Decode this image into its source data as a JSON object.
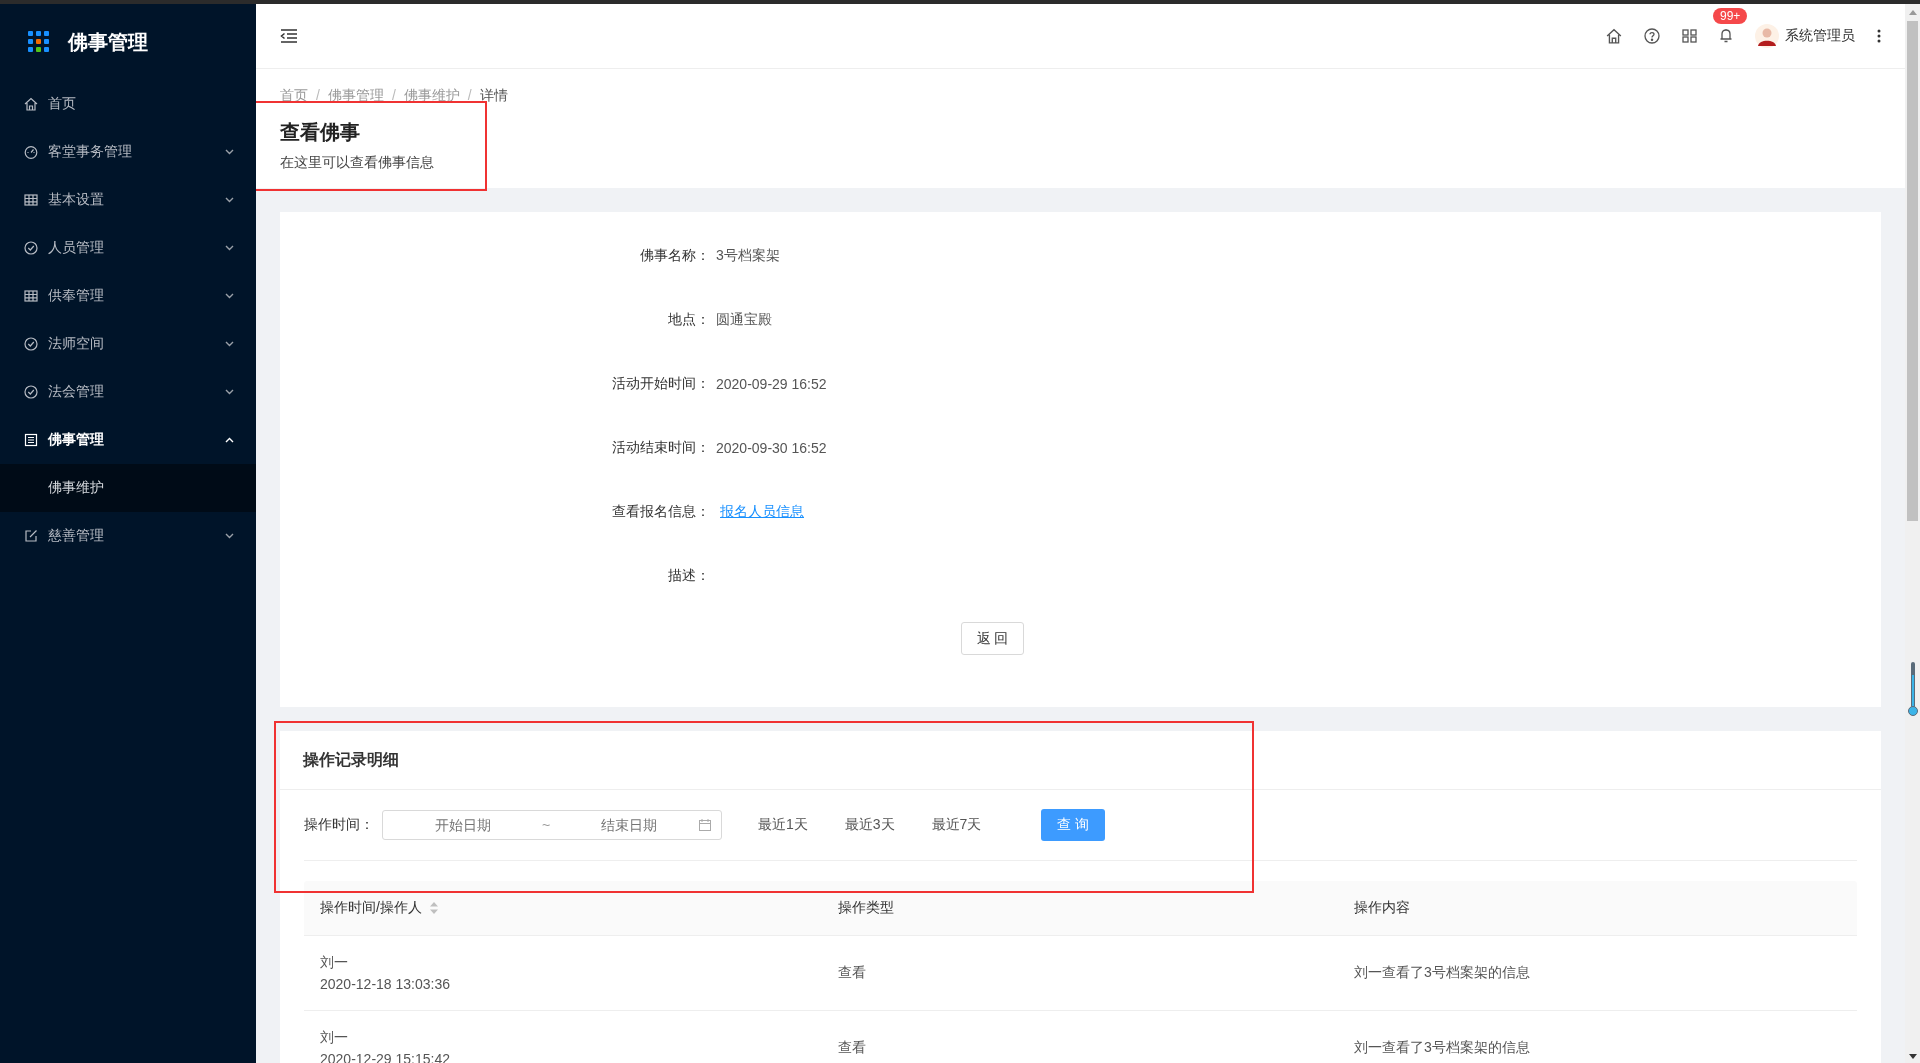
{
  "app": {
    "title": "佛事管理"
  },
  "sidebar": {
    "items": [
      {
        "label": "首页",
        "kind": "link",
        "selected": false
      },
      {
        "label": "客堂事务管理",
        "kind": "group",
        "expanded": false,
        "selected": false
      },
      {
        "label": "基本设置",
        "kind": "group",
        "expanded": false,
        "selected": false
      },
      {
        "label": "人员管理",
        "kind": "group",
        "expanded": false,
        "selected": false
      },
      {
        "label": "供奉管理",
        "kind": "group",
        "expanded": false,
        "selected": false
      },
      {
        "label": "法师空间",
        "kind": "group",
        "expanded": false,
        "selected": false
      },
      {
        "label": "法会管理",
        "kind": "group",
        "expanded": false,
        "selected": false
      },
      {
        "label": "佛事管理",
        "kind": "group",
        "expanded": true,
        "selected": true,
        "children": [
          {
            "label": "佛事维护",
            "selected": true
          }
        ]
      },
      {
        "label": "慈善管理",
        "kind": "group",
        "expanded": false,
        "selected": false
      }
    ]
  },
  "header": {
    "notification_badge": "99+",
    "user_name": "系统管理员"
  },
  "breadcrumb": [
    "首页",
    "佛事管理",
    "佛事维护",
    "详情"
  ],
  "breadcrumb_separator": "/",
  "page_header": {
    "title": "查看佛事",
    "subtitle": "在这里可以查看佛事信息"
  },
  "details": {
    "fields": [
      {
        "label": "佛事名称：",
        "value": "3号档案架",
        "kind": "text"
      },
      {
        "label": "地点：",
        "value": "圆通宝殿",
        "kind": "text"
      },
      {
        "label": "活动开始时间：",
        "value": "2020-09-29 16:52",
        "kind": "text"
      },
      {
        "label": "活动结束时间：",
        "value": "2020-09-30 16:52",
        "kind": "text"
      },
      {
        "label": "查看报名信息：",
        "value": "报名人员信息",
        "kind": "link"
      },
      {
        "label": "描述："
      }
    ],
    "back_button": "返 回"
  },
  "operation_log": {
    "title": "操作记录明细",
    "filter": {
      "label": "操作时间：",
      "start_placeholder": "开始日期",
      "separator": "~",
      "end_placeholder": "结束日期",
      "quick_ranges": [
        "最近1天",
        "最近3天",
        "最近7天"
      ],
      "query_button": "查 询"
    },
    "table": {
      "columns": [
        "操作时间/操作人",
        "操作类型",
        "操作内容"
      ],
      "rows": [
        {
          "operator": "刘一",
          "time": "2020-12-18 13:03:36",
          "type": "查看",
          "content": "刘一查看了3号档案架的信息"
        },
        {
          "operator": "刘一",
          "time": "2020-12-29 15:15:42",
          "type": "查看",
          "content": "刘一查看了3号档案架的信息"
        }
      ]
    }
  }
}
